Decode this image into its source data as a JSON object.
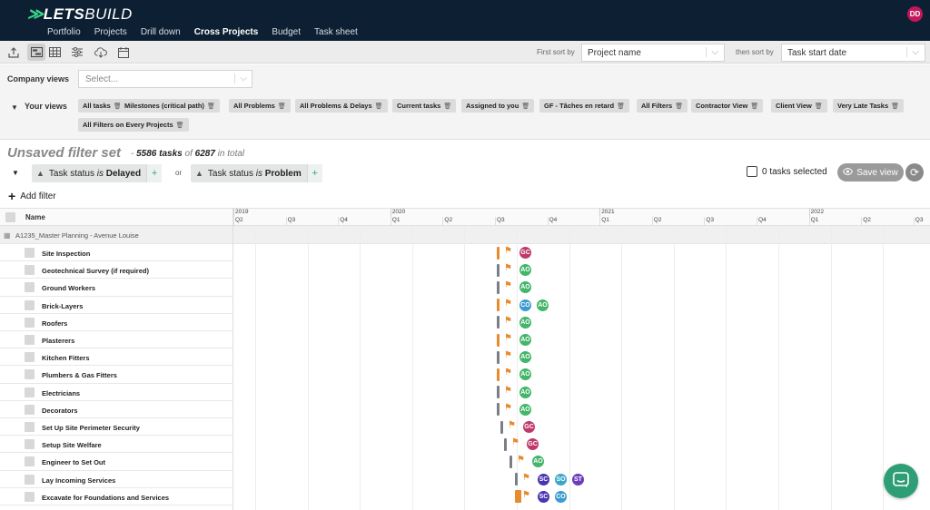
{
  "app": {
    "logo_mark": "≫",
    "logo_lets": "LETS",
    "logo_build": "BUILD",
    "user_initials": "DD"
  },
  "nav": [
    "Portfolio",
    "Projects",
    "Drill down",
    "Cross Projects",
    "Budget",
    "Task sheet"
  ],
  "nav_active": "Cross Projects",
  "sort": {
    "first_label": "First sort by",
    "first_value": "Project name",
    "then_label": "then sort by",
    "then_value": "Task start date"
  },
  "company_views": {
    "label": "Company views",
    "placeholder": "Select..."
  },
  "your_views": {
    "label": "Your views",
    "chips": [
      "All tasks",
      "Milestones (critical path)",
      "All Problems",
      "All Problems & Delays",
      "Current tasks",
      "Assigned to you",
      "GF - Tâches en retard",
      "All Filters",
      "Contractor View",
      "Client View",
      "Very Late Tasks",
      "All Filters on Every Projects"
    ]
  },
  "filter": {
    "title": "Unsaved filter set",
    "count_dash": "-",
    "count_tasks": "5586 tasks",
    "count_of": "of",
    "count_total": "6287",
    "count_suffix": "in total",
    "chip1_field": "Task status",
    "chip1_is": "is",
    "chip1_value": "Delayed",
    "or": "or",
    "chip2_field": "Task status",
    "chip2_is": "is",
    "chip2_value": "Problem",
    "plus": "+",
    "selected": "0 tasks selected",
    "save_view": "Save view",
    "add_filter": "Add filter"
  },
  "grid": {
    "name_header": "Name",
    "group": "A1235_Master Planning - Avenue Louise",
    "years": [
      "2019",
      "2020",
      "2021",
      "2022"
    ],
    "quarters": [
      "Q2",
      "Q3",
      "Q4",
      "Q1",
      "Q2",
      "Q3",
      "Q4",
      "Q1",
      "Q2",
      "Q3",
      "Q4",
      "Q1",
      "Q2",
      "Q3"
    ],
    "rows": [
      {
        "name": "Site Inspection",
        "bar": "orange",
        "assignees": [
          "GC"
        ]
      },
      {
        "name": "Geotechnical Survey (if required)",
        "bar": "gray",
        "assignees": [
          "AO"
        ]
      },
      {
        "name": "Ground Workers",
        "bar": "gray",
        "assignees": [
          "AO"
        ]
      },
      {
        "name": "Brick-Layers",
        "bar": "orange",
        "assignees": [
          "CO",
          "AO"
        ]
      },
      {
        "name": "Roofers",
        "bar": "gray",
        "assignees": [
          "AO"
        ]
      },
      {
        "name": "Plasterers",
        "bar": "orange",
        "assignees": [
          "AO"
        ]
      },
      {
        "name": "Kitchen Fitters",
        "bar": "gray",
        "assignees": [
          "AO"
        ]
      },
      {
        "name": "Plumbers & Gas Fitters",
        "bar": "orange",
        "assignees": [
          "AO"
        ]
      },
      {
        "name": "Electricians",
        "bar": "gray",
        "assignees": [
          "AO"
        ]
      },
      {
        "name": "Decorators",
        "bar": "gray",
        "assignees": [
          "AO"
        ]
      },
      {
        "name": "Set Up Site Perimeter Security",
        "bar": "gray",
        "assignees": [
          "GC"
        ]
      },
      {
        "name": "Setup Site Welfare",
        "bar": "gray",
        "assignees": [
          "GC"
        ]
      },
      {
        "name": "Engineer to Set Out",
        "bar": "gray",
        "assignees": [
          "AO"
        ]
      },
      {
        "name": "Lay Incoming Services",
        "bar": "gray",
        "assignees": [
          "SC",
          "SO",
          "ST"
        ]
      },
      {
        "name": "Excavate for Foundations and Services",
        "bar": "orange",
        "assignees": [
          "SC",
          "CO"
        ]
      }
    ]
  },
  "colors": {
    "topbar": "#0d2033",
    "accent_green": "#39d98a",
    "bar_orange": "#e88a2e",
    "bar_gray": "#7a7f87",
    "GC": "#c0396b",
    "AO": "#43b66a",
    "CO": "#3b9bd1",
    "SC": "#4a35b0",
    "SO": "#3aa7c9",
    "ST": "#6b3dbb"
  }
}
